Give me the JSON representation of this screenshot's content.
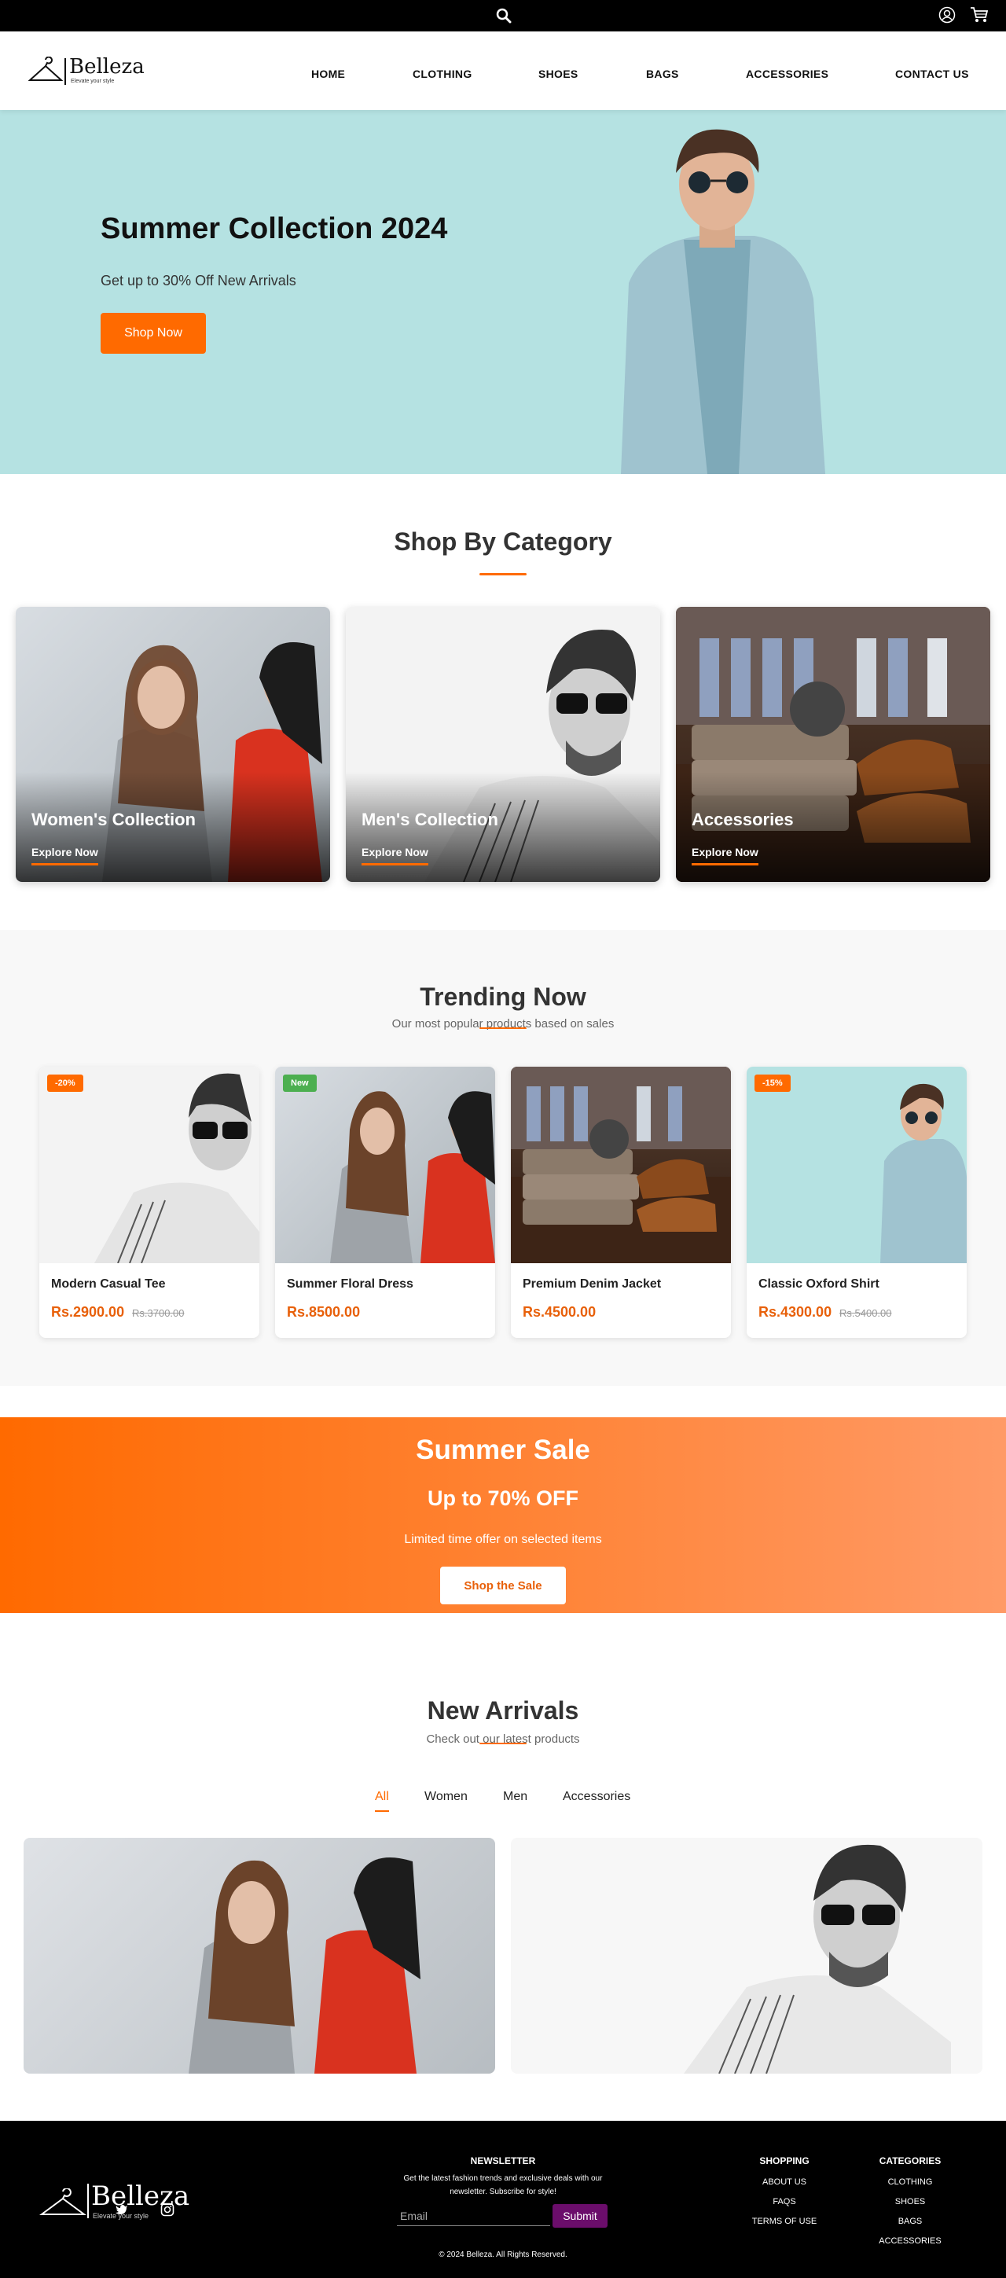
{
  "brand": {
    "name": "Belleza",
    "tagline": "Elevate your style"
  },
  "nav": {
    "items": [
      "HOME",
      "CLOTHING",
      "SHOES",
      "BAGS",
      "ACCESSORIES",
      "CONTACT US"
    ]
  },
  "hero": {
    "title": "Summer Collection 2024",
    "subtitle": "Get up to 30% Off New Arrivals",
    "cta": "Shop Now"
  },
  "categories": {
    "title": "Shop By Category",
    "items": [
      {
        "title": "Women's Collection",
        "link": "Explore Now"
      },
      {
        "title": "Men's Collection",
        "link": "Explore Now"
      },
      {
        "title": "Accessories",
        "link": "Explore Now"
      }
    ]
  },
  "trending": {
    "title": "Trending Now",
    "subtitle": "Our most popular products based on sales",
    "products": [
      {
        "badge": "-20%",
        "name": "Modern Casual Tee",
        "price": "Rs.2900.00",
        "old_price": "Rs.3700.00"
      },
      {
        "badge": "New",
        "name": "Summer Floral Dress",
        "price": "Rs.8500.00",
        "old_price": ""
      },
      {
        "badge": "",
        "name": "Premium Denim Jacket",
        "price": "Rs.4500.00",
        "old_price": ""
      },
      {
        "badge": "-15%",
        "name": "Classic Oxford Shirt",
        "price": "Rs.4300.00",
        "old_price": "Rs.5400.00"
      }
    ]
  },
  "sale": {
    "title": "Summer Sale",
    "offer": "Up to 70% OFF",
    "desc": "Limited time offer on selected items",
    "cta": "Shop the Sale"
  },
  "arrivals": {
    "title": "New Arrivals",
    "subtitle": "Check out our latest products",
    "tabs": [
      "All",
      "Women",
      "Men",
      "Accessories"
    ]
  },
  "footer": {
    "newsletter_title": "NEWSLETTER",
    "newsletter_text": "Get the latest fashion trends and exclusive deals with our newsletter. Subscribe for style!",
    "email_placeholder": "Email",
    "submit": "Submit",
    "shopping_title": "SHOPPING",
    "shopping_links": [
      "ABOUT US",
      "FAQS",
      "TERMS OF USE"
    ],
    "categories_title": "CATEGORIES",
    "categories_links": [
      "CLOTHING",
      "SHOES",
      "BAGS",
      "ACCESSORIES"
    ],
    "copyright": "© 2024 Belleza. All Rights Reserved."
  },
  "colors": {
    "accent": "#ff6a00",
    "hero_bg": "#b5e2e2",
    "submit": "#6b0d6b",
    "new_badge": "#4caf50"
  }
}
